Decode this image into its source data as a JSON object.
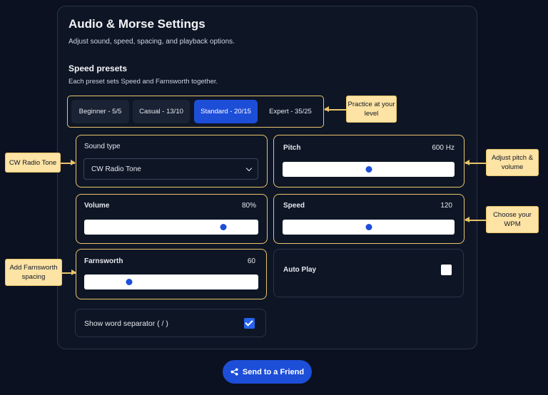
{
  "header": {
    "title": "Audio & Morse Settings",
    "subtitle": "Adjust sound, speed, spacing, and playback options."
  },
  "presets": {
    "title": "Speed presets",
    "subtitle": "Each preset sets Speed and Farnsworth together.",
    "items": [
      {
        "label": "Beginner - 5/5",
        "active": false
      },
      {
        "label": "Casual - 13/10",
        "active": false
      },
      {
        "label": "Standard - 20/15",
        "active": true
      },
      {
        "label": "Expert - 35/25",
        "active": false
      }
    ]
  },
  "sound_type": {
    "label": "Sound type",
    "selected": "CW Radio Tone"
  },
  "pitch": {
    "label": "Pitch",
    "value_text": "600 Hz",
    "level": 0.5
  },
  "volume": {
    "label": "Volume",
    "value_text": "80%",
    "level": 0.8
  },
  "speed": {
    "label": "Speed",
    "value_text": "120",
    "level": 0.5
  },
  "farnsworth": {
    "label": "Farnsworth",
    "value_text": "60",
    "level": 0.26
  },
  "auto_play": {
    "label": "Auto Play",
    "checked": false
  },
  "word_separator": {
    "label": "Show word separator ( / )",
    "checked": true
  },
  "send_button": {
    "label": "Send to a Friend",
    "icon": "share-icon"
  },
  "callouts": {
    "presets": "Practice at your level",
    "sound_type": "CW Radio Tone",
    "pitch": "Adjust pitch & volume",
    "speed": "Choose your WPM",
    "farnsworth": "Add Farnsworth spacing"
  },
  "colors": {
    "background": "#0b1120",
    "accent": "#1d4ed8",
    "highlight": "#e9c46a",
    "callout_fill": "#fde3a4"
  }
}
